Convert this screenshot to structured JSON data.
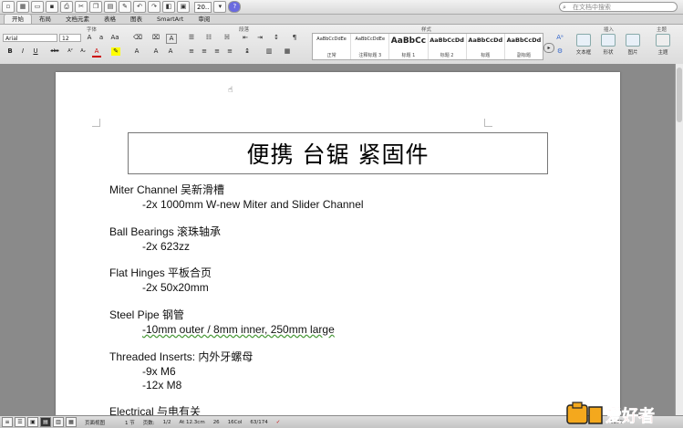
{
  "toolbar": {
    "zoom_value": "20..",
    "search_placeholder": "在文档中搜索",
    "help_label": "?"
  },
  "tabs": [
    "开始",
    "布局",
    "文档元素",
    "表格",
    "图表",
    "SmartArt",
    "审阅"
  ],
  "ribbon": {
    "groups": {
      "font": "字体",
      "paragraph": "段落",
      "styles": "样式",
      "insert": "插入",
      "themes": "主题"
    },
    "font_name": "Arial",
    "font_size": "12",
    "styles": [
      {
        "sample": "AaBbCcDdEe",
        "name": "正常"
      },
      {
        "sample": "AaBbCcDdEe",
        "name": "注释标题 3"
      },
      {
        "sample": "AaBbCc",
        "name": "标题 1"
      },
      {
        "sample": "AaBbCcDd",
        "name": "标题 2"
      },
      {
        "sample": "AaBbCcDd",
        "name": "标题"
      },
      {
        "sample": "AaBbCcDd",
        "name": "副标题"
      }
    ],
    "insert_buttons": [
      "文本框",
      "形状",
      "图片"
    ],
    "theme_button": "主题"
  },
  "document": {
    "title": "便携 台锯 紧固件",
    "sections": [
      {
        "heading": "Miter Channel 吴新滑槽",
        "items": [
          "-2x 1000mm W-new Miter and Slider Channel"
        ]
      },
      {
        "heading": "Ball Bearings 滚珠轴承",
        "items": [
          "-2x 623zz"
        ]
      },
      {
        "heading": "Flat Hinges 平板合页",
        "items": [
          "-2x 50x20mm"
        ]
      },
      {
        "heading": "Steel Pipe 钢管",
        "items": [
          "-10mm outer / 8mm inner, 250mm large"
        ]
      },
      {
        "heading": "Threaded Inserts: 内外牙螺母",
        "items": [
          "-9x M6",
          "-12x M8"
        ]
      },
      {
        "heading": "Electrical 与电有关",
        "items": []
      }
    ]
  },
  "status": {
    "view": "页面视图",
    "section": "1 节",
    "pages_label": "页数:",
    "pages": "1/2",
    "position": "At 12.3cm",
    "line": "26",
    "col": "16Col",
    "words": "63/174",
    "zoom": "200%"
  },
  "watermark": {
    "text": "爱好者"
  }
}
